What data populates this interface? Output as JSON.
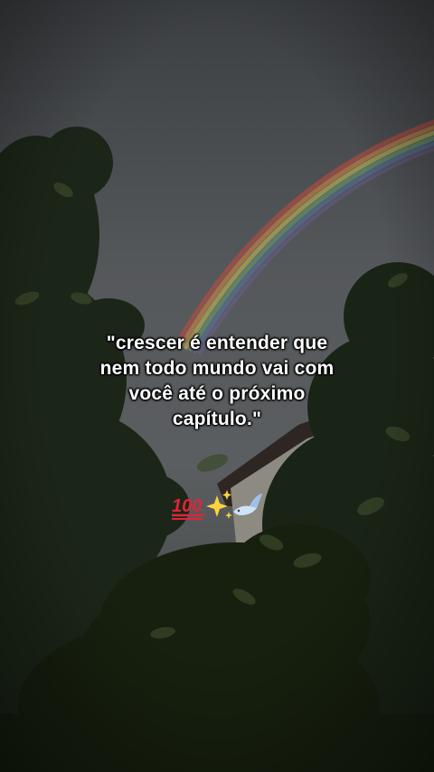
{
  "caption": {
    "line1": "\"crescer é entender que",
    "line2": "nem todo mundo vai com",
    "line3": "você até o próximo",
    "line4": "capítulo.\""
  },
  "emojis": [
    "hundred-points",
    "sparkles",
    "dove"
  ],
  "colors": {
    "sky": "#4a4d51",
    "foliage": "#1f2a1c",
    "text": "#ffffff"
  }
}
